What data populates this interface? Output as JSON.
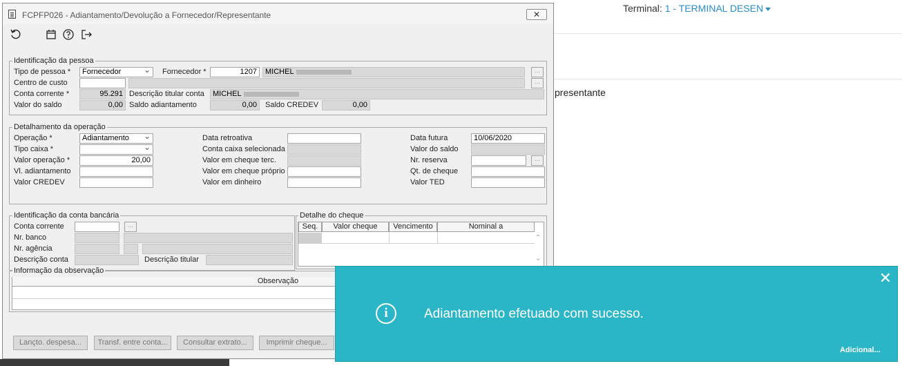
{
  "background": {
    "terminal_label": "Terminal:",
    "terminal_value": "1 - TERMINAL DESEN",
    "page_text": "presentante"
  },
  "window": {
    "title": "FCPFP026 - Adiantamento/Devolução a Fornecedor/Representante",
    "close_glyph": "✕"
  },
  "toolbar": {
    "icons": [
      "refresh-icon",
      "calendar-icon",
      "help-icon",
      "exit-icon"
    ]
  },
  "id_pessoa": {
    "title": "Identificação da pessoa",
    "tipo_pessoa_label": "Tipo de pessoa *",
    "tipo_pessoa_value": "Fornecedor",
    "fornecedor_label": "Fornecedor *",
    "fornecedor_code": "1207",
    "fornecedor_name": "MICHEL",
    "centro_custo_label": "Centro de custo",
    "conta_corrente_label": "Conta corrente *",
    "conta_corrente_value": "95.291",
    "desc_titular_label": "Descrição titular conta",
    "desc_titular_value": "MICHEL",
    "valor_saldo_label": "Valor do saldo",
    "valor_saldo_value": "0,00",
    "saldo_adiant_label": "Saldo adiantamento",
    "saldo_adiant_value": "0,00",
    "saldo_credev_label": "Saldo CREDEV",
    "saldo_credev_value": "0,00"
  },
  "detalhamento": {
    "title": "Detalhamento da operação",
    "operacao_label": "Operação *",
    "operacao_value": "Adiantamento",
    "tipo_caixa_label": "Tipo caixa *",
    "valor_operacao_label": "Valor operação *",
    "valor_operacao_value": "20,00",
    "vl_adiant_label": "Vl. adiantamento",
    "valor_credev_label": "Valor CREDEV",
    "data_retro_label": "Data retroativa",
    "conta_caixa_label": "Conta caixa selecionada",
    "cheque_terc_label": "Valor em cheque terc.",
    "cheque_proprio_label": "Valor em cheque próprio",
    "dinheiro_label": "Valor em dinheiro",
    "data_futura_label": "Data futura",
    "data_futura_value": "10/06/2020",
    "valor_saldo_label": "Valor do saldo",
    "nr_reserva_label": "Nr. reserva",
    "qt_cheque_label": "Qt. de cheque",
    "valor_ted_label": "Valor TED"
  },
  "conta_bancaria": {
    "title": "Identificação da conta bancária",
    "conta_corrente_label": "Conta corrente",
    "nr_banco_label": "Nr. banco",
    "nr_agencia_label": "Nr. agência",
    "desc_conta_label": "Descrição conta",
    "desc_titular_label": "Descrição titular"
  },
  "cheque": {
    "title": "Detalhe do cheque",
    "columns": [
      "Seq.",
      "Valor cheque",
      "Vencimento",
      "Nominal a"
    ]
  },
  "observacao": {
    "title": "Informação da observação",
    "column": "Observação"
  },
  "buttons": {
    "lancto": "Lançto. despesa...",
    "transf": "Transf. entre conta...",
    "consultar": "Consultar extrato...",
    "imprimir": "Imprimir cheque..."
  },
  "toast": {
    "message": "Adiantamento efetuado com sucesso.",
    "link": "Adicional...",
    "close_glyph": "✕",
    "info_glyph": "i",
    "color": "#2bb6c7"
  }
}
